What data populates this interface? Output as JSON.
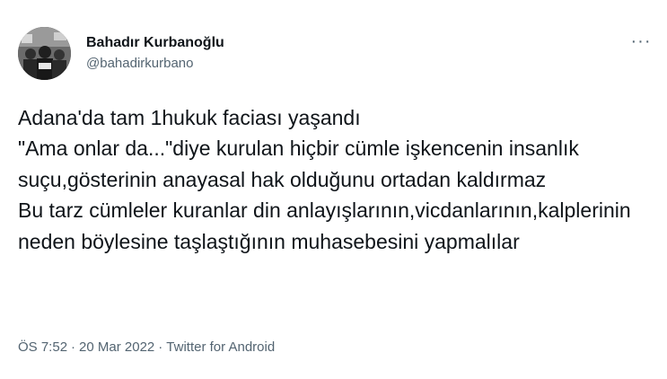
{
  "author": {
    "display_name": "Bahadır Kurbanoğlu",
    "handle": "@bahadirkurbano",
    "avatar_icon": "profile-photo"
  },
  "more_icon": "more-horizontal-icon",
  "more_label": "···",
  "tweet": {
    "text": "Adana'da tam 1hukuk faciası yaşandı\n\"Ama onlar da...\"diye kurulan hiçbir cümle işkencenin insanlık suçu,gösterinin anayasal hak olduğunu ortadan kaldırmaz\nBu tarz cümleler kuranlar din anlayışlarının,vicdanlarının,kalplerinin neden böylesine taşlaştığının muhasebesini yapmalılar"
  },
  "meta": {
    "time": "ÖS 7:52",
    "separator": "·",
    "date": "20 Mar 2022",
    "source": "Twitter for Android"
  },
  "colors": {
    "text": "#0f1419",
    "secondary": "#536471",
    "background": "#ffffff"
  }
}
